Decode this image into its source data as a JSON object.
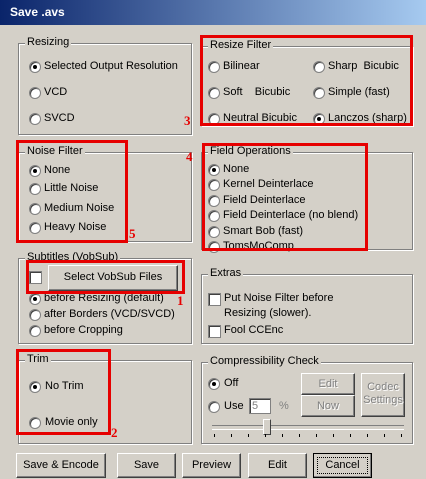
{
  "window": {
    "title": "Save .avs"
  },
  "resizing": {
    "title": "Resizing",
    "options": [
      "Selected Output Resolution",
      "VCD",
      "SVCD"
    ],
    "selected": 0
  },
  "resize_filter": {
    "title": "Resize Filter",
    "options": [
      "Bilinear",
      "Sharp  Bicubic",
      "Soft    Bicubic",
      "Simple (fast)",
      "Neutral Bicubic",
      "Lanczos (sharp)"
    ],
    "selected": 5
  },
  "noise_filter": {
    "title": "Noise Filter",
    "options": [
      "None",
      "Little Noise",
      "Medium Noise",
      "Heavy Noise"
    ],
    "selected": 0
  },
  "field_operations": {
    "title": "Field Operations",
    "options": [
      "None",
      "Kernel Deinterlace",
      "Field Deinterlace",
      "Field Deinterlace (no blend)",
      "Smart Bob (fast)",
      "TomsMoComp"
    ],
    "selected": 0
  },
  "subtitles": {
    "title": "Subtitles (VobSub)",
    "button": "Select VobSub Files",
    "options": [
      "before Resizing (default)",
      "after Borders (VCD/SVCD)",
      "before Cropping"
    ],
    "selected": 0
  },
  "extras": {
    "title": "Extras",
    "noise_line1": "Put Noise Filter before",
    "noise_line2": "Resizing (slower).",
    "fool": "Fool CCEnc"
  },
  "trim": {
    "title": "Trim",
    "options": [
      "No Trim",
      "Movie only"
    ],
    "selected": 0
  },
  "compressibility": {
    "title": "Compressibility Check",
    "off": "Off",
    "use": "Use",
    "value": "5",
    "percent": "%",
    "edit": "Edit",
    "now": "Now",
    "codec1": "Codec",
    "codec2": "Settings"
  },
  "buttons": {
    "save_encode": "Save & Encode",
    "save": "Save",
    "preview": "Preview",
    "edit": "Edit",
    "cancel": "Cancel"
  },
  "annotations": [
    "1",
    "2",
    "3",
    "4",
    "5"
  ],
  "colors": {
    "annotation": "#e60000",
    "title_bar": "#0a246a",
    "face": "#d4d0c8"
  }
}
